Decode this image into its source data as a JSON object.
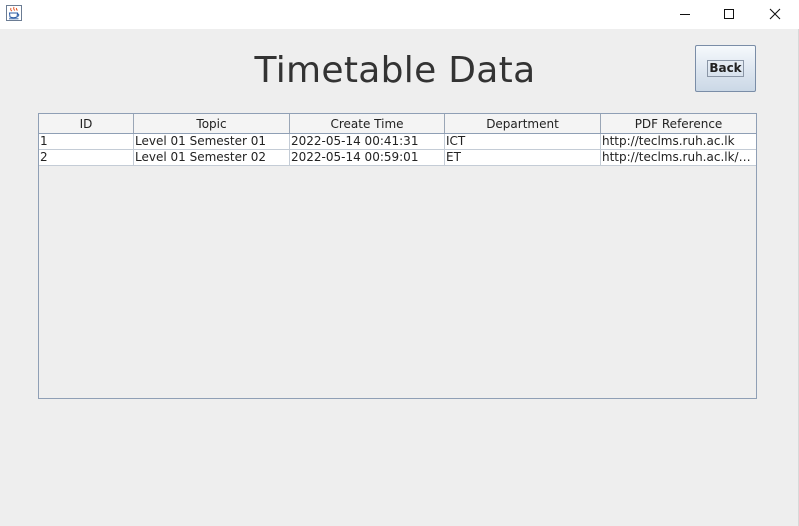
{
  "window": {
    "icon": "java-cup-icon",
    "controls": {
      "minimize_icon": "minimize-icon",
      "maximize_icon": "maximize-icon",
      "close_icon": "close-icon"
    }
  },
  "page": {
    "title": "Timetable Data",
    "back_label": "Back"
  },
  "table": {
    "columns": [
      "ID",
      "Topic",
      "Create Time",
      "Department",
      "PDF Reference"
    ],
    "rows": [
      [
        "1",
        "Level 01 Semester 01",
        "2022-05-14 00:41:31",
        "ICT",
        "http://teclms.ruh.ac.lk"
      ],
      [
        "2",
        "Level 01 Semester 02",
        "2022-05-14 00:59:01",
        "ET",
        "http://teclms.ruh.ac.lk/moo..."
      ]
    ]
  },
  "colors": {
    "window_bg": "#eeeeee",
    "titlebar_bg": "#ffffff",
    "table_border": "#8f9fb5",
    "button_border": "#7a8da7",
    "text": "#222222"
  }
}
